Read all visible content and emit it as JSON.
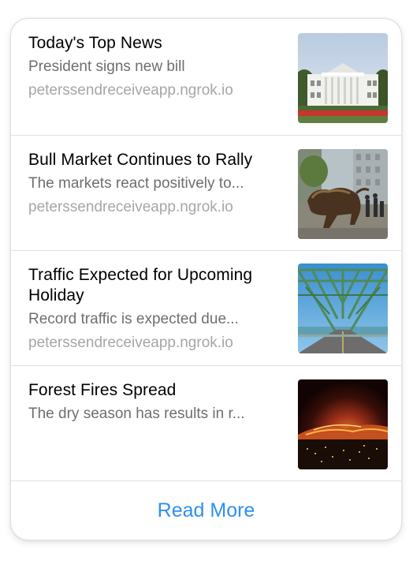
{
  "news": {
    "items": [
      {
        "title": "Today's Top News",
        "summary": "President signs new bill",
        "source": "peterssendreceiveapp.ngrok.io",
        "image": "white-house-photo"
      },
      {
        "title": "Bull Market Continues to Rally",
        "summary": "The markets react positively to...",
        "source": "peterssendreceiveapp.ngrok.io",
        "image": "charging-bull-statue-photo"
      },
      {
        "title": "Traffic Expected for Upcoming Holiday",
        "summary": "Record traffic is expected due...",
        "source": "peterssendreceiveapp.ngrok.io",
        "image": "truss-bridge-photo"
      },
      {
        "title": "Forest Fires Spread",
        "summary": "The dry season has results in r...",
        "source": "",
        "image": "forest-fire-night-photo"
      }
    ],
    "read_more_label": "Read More",
    "accent_color": "#2f8ff0"
  }
}
